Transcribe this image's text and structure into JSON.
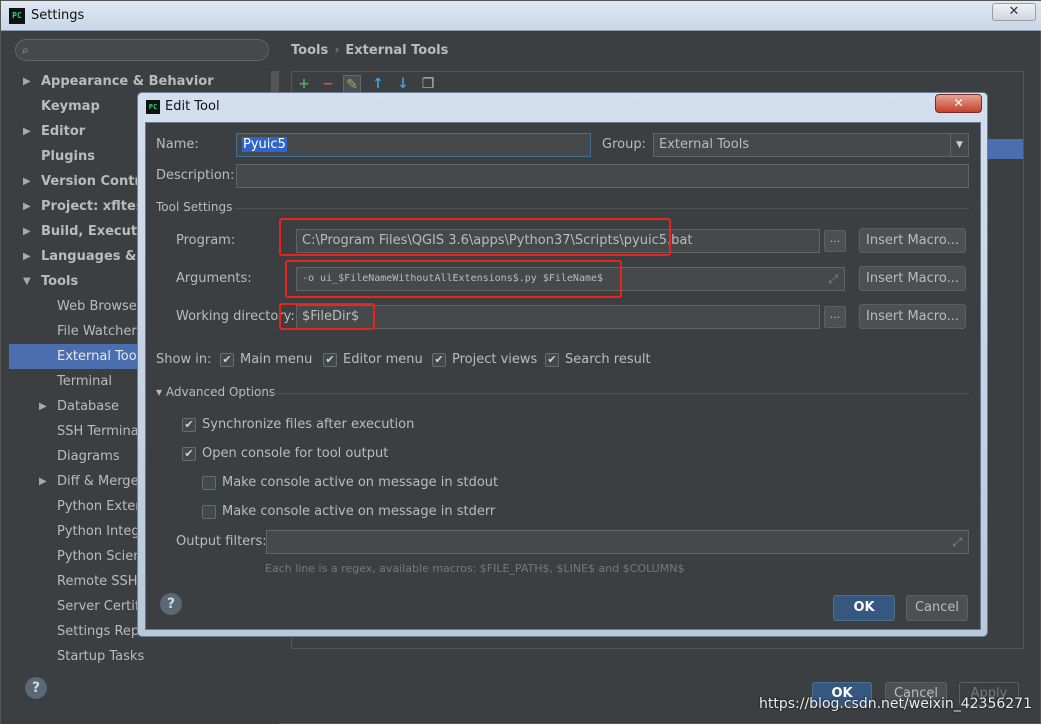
{
  "settings": {
    "window_title": "Settings",
    "app_icon_text": "PC",
    "close_glyph": "✕",
    "help_glyph": "?",
    "search_icon": "⌕",
    "breadcrumb": [
      "Tools",
      "External Tools"
    ],
    "breadcrumb_sep": "›",
    "buttons": {
      "ok": "OK",
      "cancel": "Cancel",
      "apply": "Apply"
    },
    "toolbar_icons": [
      {
        "name": "add-icon",
        "glyph": "+",
        "color": "#59a869"
      },
      {
        "name": "remove-icon",
        "glyph": "−",
        "color": "#c75450"
      },
      {
        "name": "edit-icon",
        "glyph": "✎",
        "color": "#8fb35e"
      },
      {
        "name": "move-up-icon",
        "glyph": "↑",
        "color": "#40a0e0"
      },
      {
        "name": "move-down-icon",
        "glyph": "↓",
        "color": "#40a0e0"
      },
      {
        "name": "copy-icon",
        "glyph": "❐",
        "color": "#bbbbbb"
      }
    ],
    "watermark": "https://blog.csdn.net/weixin_42356271"
  },
  "sidebar": {
    "items": [
      {
        "label": "Appearance & Behavior",
        "expanded": false,
        "arrow": true,
        "bold": true,
        "indent": 0
      },
      {
        "label": "Keymap",
        "arrow": false,
        "bold": true,
        "indent": 0
      },
      {
        "label": "Editor",
        "arrow": true,
        "bold": true,
        "indent": 0
      },
      {
        "label": "Plugins",
        "arrow": false,
        "bold": true,
        "indent": 0
      },
      {
        "label": "Version Control",
        "arrow": true,
        "bold": true,
        "indent": 0
      },
      {
        "label": "Project: xfltest",
        "arrow": true,
        "bold": true,
        "indent": 0
      },
      {
        "label": "Build, Execution",
        "arrow": true,
        "bold": true,
        "indent": 0
      },
      {
        "label": "Languages & Fr",
        "arrow": true,
        "bold": true,
        "indent": 0
      },
      {
        "label": "Tools",
        "arrow": true,
        "expanded": true,
        "bold": true,
        "indent": 0
      },
      {
        "label": "Web Browsers",
        "arrow": false,
        "bold": false,
        "indent": 1
      },
      {
        "label": "File Watchers",
        "arrow": false,
        "bold": false,
        "indent": 1
      },
      {
        "label": "External Tools",
        "arrow": false,
        "bold": false,
        "indent": 1,
        "selected": true
      },
      {
        "label": "Terminal",
        "arrow": false,
        "bold": false,
        "indent": 1
      },
      {
        "label": "Database",
        "arrow": true,
        "bold": false,
        "indent": 1
      },
      {
        "label": "SSH Terminal",
        "arrow": false,
        "bold": false,
        "indent": 1
      },
      {
        "label": "Diagrams",
        "arrow": false,
        "bold": false,
        "indent": 1
      },
      {
        "label": "Diff & Merge",
        "arrow": true,
        "bold": false,
        "indent": 1
      },
      {
        "label": "Python Extern",
        "arrow": false,
        "bold": false,
        "indent": 1
      },
      {
        "label": "Python Integr",
        "arrow": false,
        "bold": false,
        "indent": 1
      },
      {
        "label": "Python Scienti",
        "arrow": false,
        "bold": false,
        "indent": 1
      },
      {
        "label": "Remote SSH E",
        "arrow": false,
        "bold": false,
        "indent": 1
      },
      {
        "label": "Server Certific",
        "arrow": false,
        "bold": false,
        "indent": 1
      },
      {
        "label": "Settings Repo",
        "arrow": false,
        "bold": false,
        "indent": 1
      },
      {
        "label": "Startup Tasks",
        "arrow": false,
        "bold": false,
        "indent": 1
      }
    ]
  },
  "dialog": {
    "title": "Edit Tool",
    "name_label": "Name:",
    "name_value": "Pyuic5",
    "group_label": "Group:",
    "group_value": "External Tools",
    "description_label": "Description:",
    "description_value": "",
    "tool_settings_label": "Tool Settings",
    "program_label": "Program:",
    "program_value": "C:\\Program Files\\QGIS 3.6\\apps\\Python37\\Scripts\\pyuic5.bat",
    "arguments_label": "Arguments:",
    "arguments_value": "-o ui_$FileNameWithoutAllExtensions$.py $FileName$",
    "working_dir_label": "Working directory:",
    "working_dir_value": "$FileDir$",
    "insert_macro": "Insert Macro...",
    "ellipsis": "...",
    "show_in_label": "Show in:",
    "show_in": [
      {
        "label": "Main menu",
        "checked": true
      },
      {
        "label": "Editor menu",
        "checked": true
      },
      {
        "label": "Project views",
        "checked": true
      },
      {
        "label": "Search result",
        "checked": true
      }
    ],
    "advanced_label": "Advanced Options",
    "sync_files": {
      "label": "Synchronize files after execution",
      "checked": true
    },
    "open_console": {
      "label": "Open console for tool output",
      "checked": true
    },
    "console_stdout": {
      "label": "Make console active on message in stdout",
      "checked": false
    },
    "console_stderr": {
      "label": "Make console active on message in stderr",
      "checked": false
    },
    "output_filters_label": "Output filters:",
    "output_filters_value": "",
    "hint": "Each line is a regex, available macros: $FILE_PATH$, $LINE$ and $COLUMN$",
    "ok": "OK",
    "cancel": "Cancel",
    "check_glyph": "✔",
    "expand_glyph": "⤢",
    "collapse_glyph": "▾"
  },
  "colors": {
    "highlight_box": "#e8251c",
    "selection": "#4b6eaf",
    "ok_button": "#365880"
  }
}
